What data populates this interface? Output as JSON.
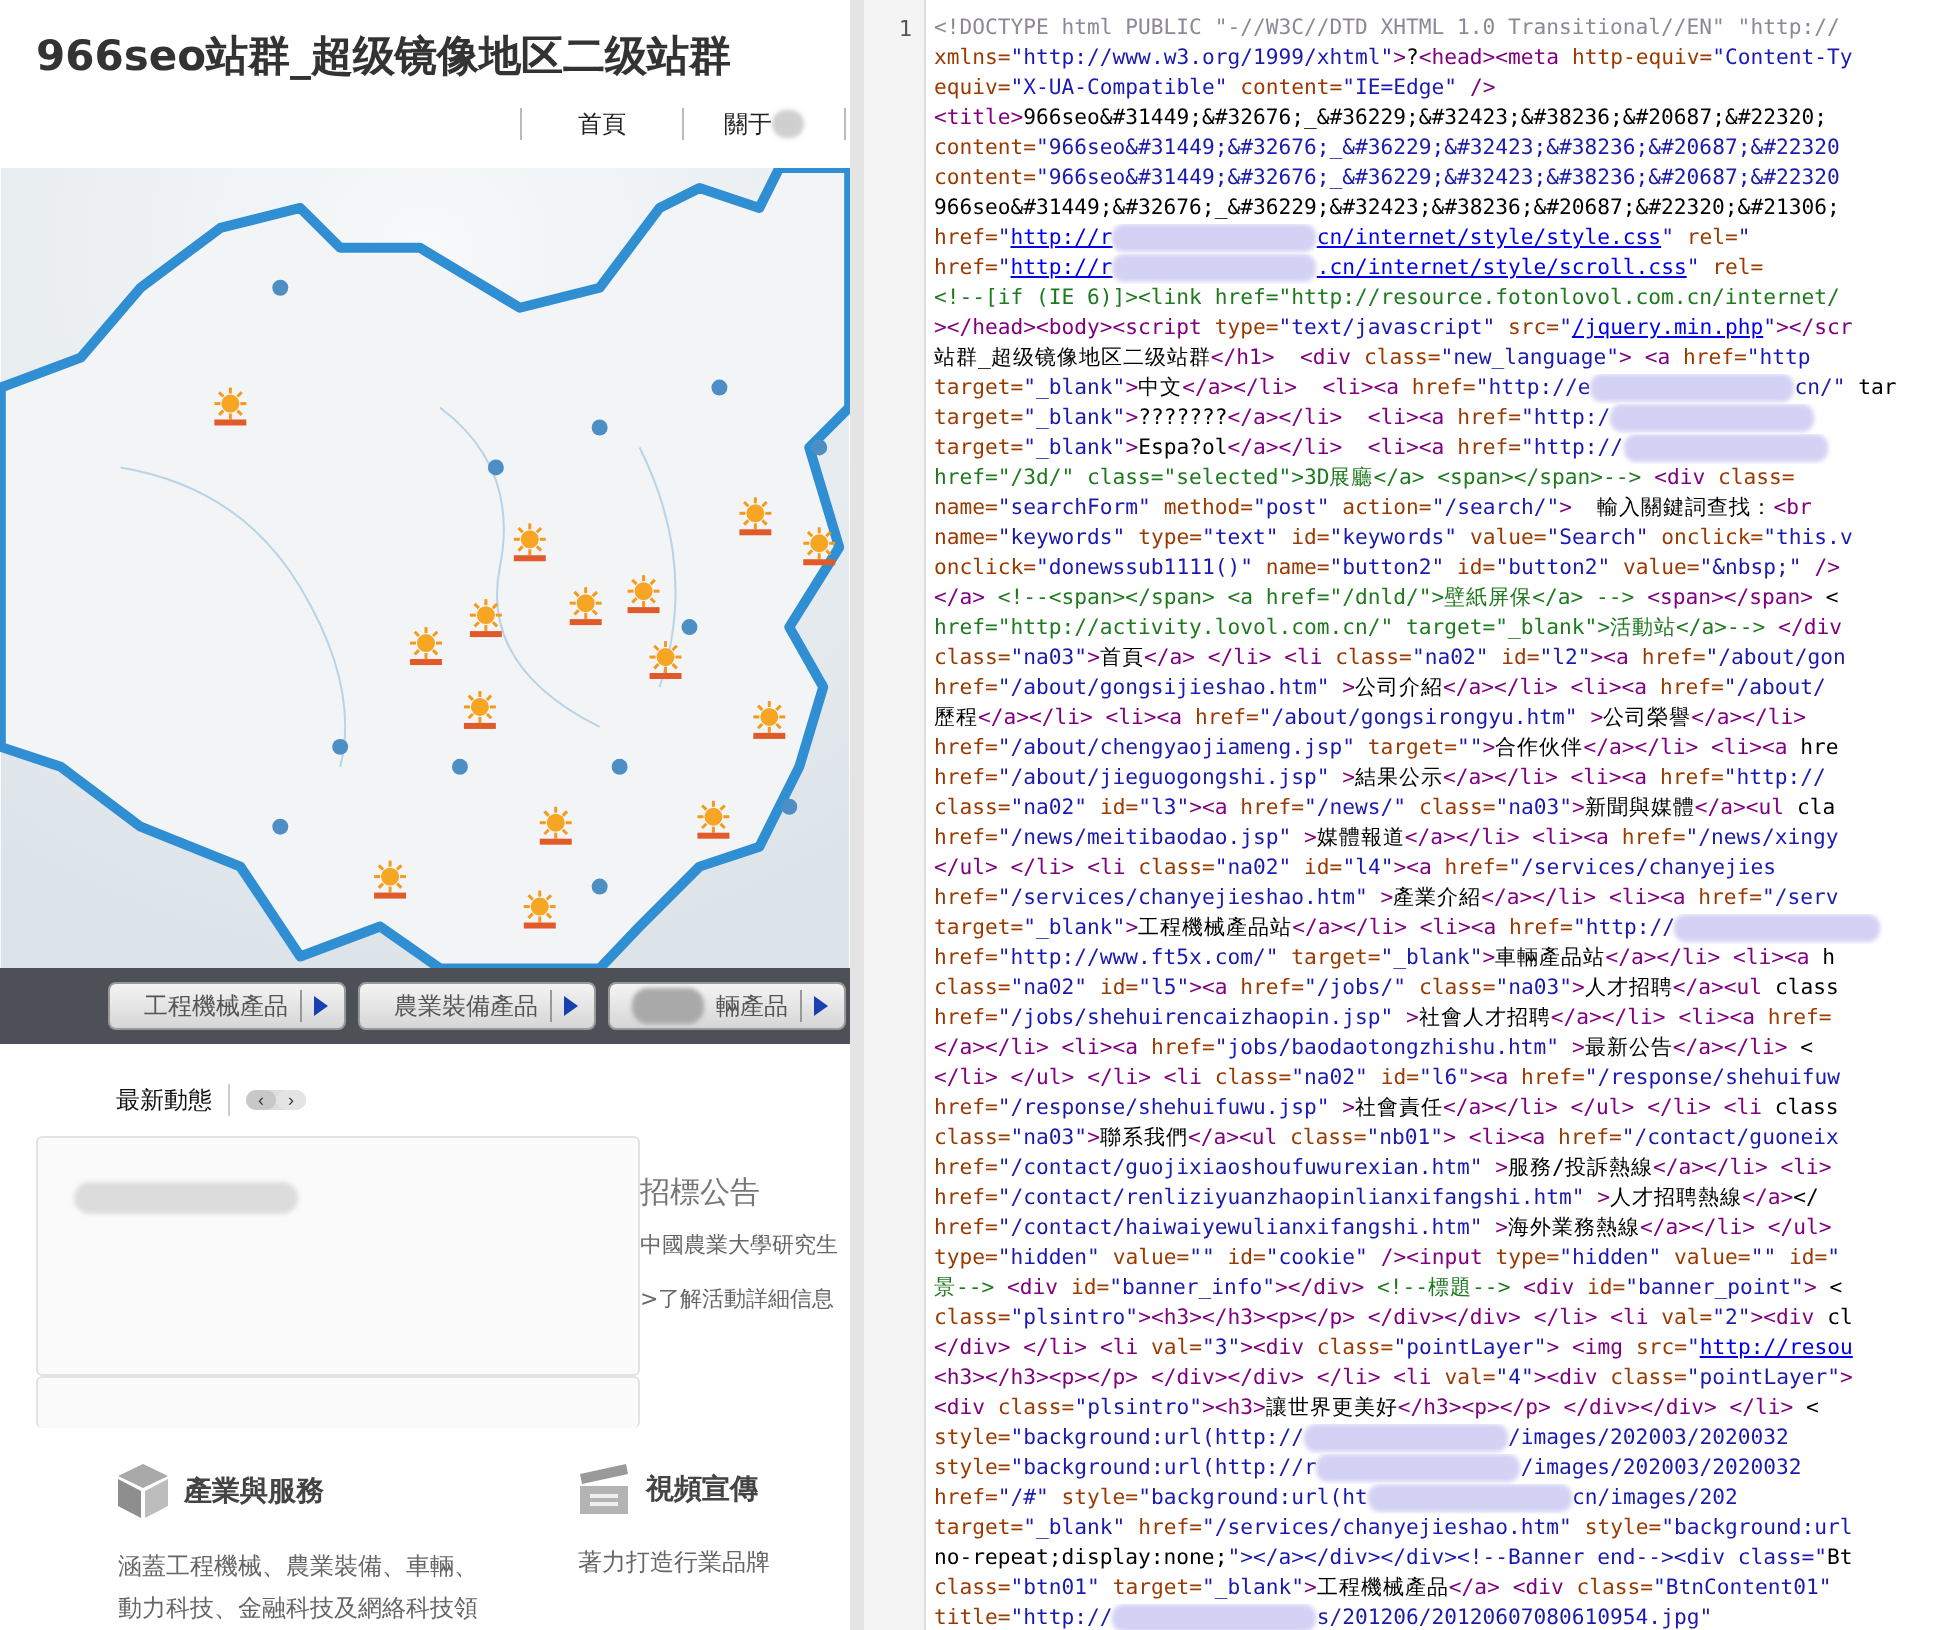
{
  "site": {
    "title": "966seo站群_超级镜像地区二级站群",
    "nav": [
      {
        "label": "首頁",
        "redacted": false
      },
      {
        "label": "關于",
        "redacted": true
      }
    ],
    "category_buttons": [
      {
        "label": "工程機械產品",
        "redacted": false
      },
      {
        "label": "農業裝備產品",
        "redacted": false
      },
      {
        "label": "輛產品",
        "redacted": true
      }
    ],
    "news": {
      "heading": "最新動態",
      "prev": "‹",
      "next": "›"
    },
    "tenders": {
      "heading": "招標公告",
      "item": "中國農業大學研究生",
      "more": ">了解活動詳細信息"
    },
    "features": [
      {
        "kind": "cube",
        "title": "產業與服務",
        "text": "涵蓋工程機械、農業裝備、車輛、動力科技、金融科技及網絡科技領"
      },
      {
        "kind": "clapper",
        "title": "視頻宣傳",
        "text": "著力打造行業品牌"
      }
    ]
  },
  "source": {
    "line_number": "1",
    "lines": [
      {
        "parts": [
          {
            "kind": "doctype",
            "text": "<!DOCTYPE html PUBLIC \"-//W3C//DTD XHTML 1.0 Transitional//EN\" \"http://"
          }
        ]
      },
      {
        "parts": [
          {
            "kind": "code",
            "text": "xmlns=\"http://www.w3.org/1999/xhtml\">?<head><meta http-equiv=\"Content-Ty"
          }
        ]
      },
      {
        "parts": [
          {
            "kind": "code",
            "text": "equiv=\"X-UA-Compatible\" content=\"IE=Edge\" />"
          }
        ]
      },
      {
        "parts": [
          {
            "kind": "code",
            "text": "<title>966seo&#31449;&#32676;_&#36229;&#32423;&#38236;&#20687;&#22320;"
          }
        ]
      },
      {
        "parts": [
          {
            "kind": "code",
            "text": "content=\"966seo&#31449;&#32676;_&#36229;&#32423;&#38236;&#20687;&#22320"
          }
        ]
      },
      {
        "parts": [
          {
            "kind": "code",
            "text": "content=\"966seo&#31449;&#32676;_&#36229;&#32423;&#38236;&#20687;&#22320"
          }
        ]
      },
      {
        "parts": [
          {
            "kind": "code",
            "text": "966seo&#31449;&#32676;_&#36229;&#32423;&#38236;&#20687;&#22320;&#21306;"
          }
        ]
      },
      {
        "parts": [
          {
            "kind": "code",
            "text": "href=\""
          },
          {
            "kind": "link",
            "text": "http://r"
          },
          {
            "kind": "redacted"
          },
          {
            "kind": "link",
            "text": "cn/internet/style/style.css"
          },
          {
            "kind": "code",
            "text": "\" rel=\""
          }
        ]
      },
      {
        "parts": [
          {
            "kind": "code",
            "text": "href=\""
          },
          {
            "kind": "link",
            "text": "http://r"
          },
          {
            "kind": "redacted"
          },
          {
            "kind": "link",
            "text": ".cn/internet/style/scroll.css"
          },
          {
            "kind": "code",
            "text": "\" rel="
          }
        ]
      },
      {
        "parts": [
          {
            "kind": "code",
            "text": "<!--[if (IE 6)]><link href=\"http://resource.fotonlovol.com.cn/internet/"
          }
        ]
      },
      {
        "parts": [
          {
            "kind": "code",
            "text": "></head><body><script type=\"text/javascript\" src=\""
          },
          {
            "kind": "link",
            "text": "/jquery.min.php"
          },
          {
            "kind": "code",
            "text": "\"></scr"
          }
        ]
      },
      {
        "parts": [
          {
            "kind": "code",
            "text": "站群_超级镜像地区二级站群</h1>  <div class=\"new_language\"> <a href=\"http"
          }
        ]
      },
      {
        "parts": [
          {
            "kind": "code",
            "text": "target=\"_blank\">中文</a></li>  <li><a href=\"http://e"
          },
          {
            "kind": "redacted"
          },
          {
            "kind": "code",
            "text": "cn/\" tar"
          }
        ]
      },
      {
        "parts": [
          {
            "kind": "code",
            "text": "target=\"_blank\">???????</a></li>  <li><a href=\"http:/"
          },
          {
            "kind": "redacted"
          }
        ]
      },
      {
        "parts": [
          {
            "kind": "code",
            "text": "target=\"_blank\">Espa?ol</a></li>  <li><a href=\"http://"
          },
          {
            "kind": "redacted"
          }
        ]
      },
      {
        "parts": [
          {
            "kind": "comment",
            "text": "href=\"/3d/\" class=\"selected\">"
          },
          {
            "kind": "comment",
            "text": "3D展廳</a> <span></span>-->"
          },
          {
            "kind": "code",
            "text": " <div class="
          }
        ]
      },
      {
        "parts": [
          {
            "kind": "code",
            "text": "name=\"searchForm\" method=\"post\" action=\"/search/\">  輸入關鍵詞查找：<br"
          }
        ]
      },
      {
        "parts": [
          {
            "kind": "code",
            "text": "name=\"keywords\" type=\"text\" id=\"keywords\" value=\"Search\" onclick=\"this.v"
          }
        ]
      },
      {
        "parts": [
          {
            "kind": "code",
            "text": "onclick=\"donewssub1111()\" name=\"button2\" id=\"button2\" value=\"&nbsp;\" />"
          }
        ]
      },
      {
        "parts": [
          {
            "kind": "code",
            "text": "</a> <!--<span></span> <a href=\"/dnld/\">壁紙屏保</a> --> <span></span> <"
          }
        ]
      },
      {
        "parts": [
          {
            "kind": "comment",
            "text": "href=\"http://activity.lovol.com.cn/\" target=\"_blank\">活動站</a>-->"
          },
          {
            "kind": "code",
            "text": " </div"
          }
        ]
      },
      {
        "parts": [
          {
            "kind": "code",
            "text": "class=\"na03\">首頁</a> </li> <li class=\"na02\" id=\"l2\"><a href=\"/about/gon"
          }
        ]
      },
      {
        "parts": [
          {
            "kind": "code",
            "text": "href=\"/about/gongsijieshao.htm\" >公司介紹</a></li> <li><a href=\"/about/"
          }
        ]
      },
      {
        "parts": [
          {
            "kind": "code",
            "text": "歷程</a></li> <li><a href=\"/about/gongsirongyu.htm\" >公司榮譽</a></li>"
          }
        ]
      },
      {
        "parts": [
          {
            "kind": "code",
            "text": "href=\"/about/chengyaojiameng.jsp\" target=\"\">合作伙伴</a></li> <li><a hre"
          }
        ]
      },
      {
        "parts": [
          {
            "kind": "code",
            "text": "href=\"/about/jieguogongshi.jsp\" >結果公示</a></li> <li><a href=\"http://"
          }
        ]
      },
      {
        "parts": [
          {
            "kind": "code",
            "text": "class=\"na02\" id=\"l3\"><a href=\"/news/\" class=\"na03\">新聞與媒體</a><ul cla"
          }
        ]
      },
      {
        "parts": [
          {
            "kind": "code",
            "text": "href=\"/news/meitibaodao.jsp\" >媒體報道</a></li> <li><a href=\"/news/xingy"
          }
        ]
      },
      {
        "parts": [
          {
            "kind": "code",
            "text": "</ul> </li> <li class=\"na02\" id=\"l4\"><a href=\"/services/chanyejies"
          }
        ]
      },
      {
        "parts": [
          {
            "kind": "code",
            "text": "href=\"/services/chanyejieshao.htm\" >產業介紹</a></li> <li><a href=\"/serv"
          }
        ]
      },
      {
        "parts": [
          {
            "kind": "code",
            "text": "target=\"_blank\">工程機械產品站</a></li> <li><a href=\"http://"
          },
          {
            "kind": "redacted"
          }
        ]
      },
      {
        "parts": [
          {
            "kind": "code",
            "text": "href=\"http://www.ft5x.com/\" target=\"_blank\">車輛產品站</a></li> <li><a h"
          }
        ]
      },
      {
        "parts": [
          {
            "kind": "code",
            "text": "class=\"na02\" id=\"l5\"><a href=\"/jobs/\" class=\"na03\">人才招聘</a><ul class"
          }
        ]
      },
      {
        "parts": [
          {
            "kind": "code",
            "text": "href=\"/jobs/shehuirencaizhaopin.jsp\" >社會人才招聘</a></li> <li><a href="
          }
        ]
      },
      {
        "parts": [
          {
            "kind": "code",
            "text": "</a></li> <li><a href=\"jobs/baodaotongzhishu.htm\" >最新公告</a></li> <"
          }
        ]
      },
      {
        "parts": [
          {
            "kind": "code",
            "text": "</li> </ul> </li> <li class=\"na02\" id=\"l6\"><a href=\"/response/shehuifuw"
          }
        ]
      },
      {
        "parts": [
          {
            "kind": "code",
            "text": "href=\"/response/shehuifuwu.jsp\" >社會責任</a></li> </ul> </li> <li class"
          }
        ]
      },
      {
        "parts": [
          {
            "kind": "code",
            "text": "class=\"na03\">聯系我們</a><ul class=\"nb01\"> <li><a href=\"/contact/guoneix"
          }
        ]
      },
      {
        "parts": [
          {
            "kind": "code",
            "text": "href=\"/contact/guojixiaoshoufuwurexian.htm\" >服務/投訴熱線</a></li> <li>"
          }
        ]
      },
      {
        "parts": [
          {
            "kind": "code",
            "text": "href=\"/contact/renliziyuanzhaopinlianxifangshi.htm\" >人才招聘熱線</a></"
          }
        ]
      },
      {
        "parts": [
          {
            "kind": "code",
            "text": "href=\"/contact/haiwaiyewulianxifangshi.htm\" >海外業務熱線</a></li> </ul>"
          }
        ]
      },
      {
        "parts": [
          {
            "kind": "code",
            "text": "type=\"hidden\" value=\"\" id=\"cookie\" /><input type=\"hidden\" value=\"\" id=\""
          }
        ]
      },
      {
        "parts": [
          {
            "kind": "comment",
            "text": "景-->"
          },
          {
            "kind": "code",
            "text": " <div id=\"banner_info\"></div> <!--標題--> <div id=\"banner_point\"> <"
          }
        ]
      },
      {
        "parts": [
          {
            "kind": "code",
            "text": "class=\"plsintro\"><h3></h3><p></p> </div></div> </li> <li val=\"2\"><div cl"
          }
        ]
      },
      {
        "parts": [
          {
            "kind": "code",
            "text": "</div> </li> <li val=\"3\"><div class=\"pointLayer\"> <img src=\""
          },
          {
            "kind": "link",
            "text": "http://resou"
          }
        ]
      },
      {
        "parts": [
          {
            "kind": "code",
            "text": "<h3></h3><p></p> </div></div> </li> <li val=\"4\"><div class=\"pointLayer\">"
          }
        ]
      },
      {
        "parts": [
          {
            "kind": "code",
            "text": "<div class=\"plsintro\"><h3>讓世界更美好</h3><p></p> </div></div> </li> <"
          }
        ]
      },
      {
        "parts": [
          {
            "kind": "code",
            "text": "style=\"background:url(http://"
          },
          {
            "kind": "redacted"
          },
          {
            "kind": "code",
            "text": "/images/202003/2020032"
          }
        ]
      },
      {
        "parts": [
          {
            "kind": "code",
            "text": "style=\"background:url(http://r"
          },
          {
            "kind": "redacted"
          },
          {
            "kind": "code",
            "text": "/images/202003/2020032"
          }
        ]
      },
      {
        "parts": [
          {
            "kind": "code",
            "text": "href=\"/#\" style=\"background:url(ht"
          },
          {
            "kind": "redacted"
          },
          {
            "kind": "code",
            "text": "cn/images/202"
          }
        ]
      },
      {
        "parts": [
          {
            "kind": "code",
            "text": "target=\"_blank\" href=\"/services/chanyejieshao.htm\" style=\"background:url"
          }
        ]
      },
      {
        "parts": [
          {
            "kind": "code",
            "text": "no-repeat;display:none;\"></a></div></div><!--Banner end--><div class=\"Bt"
          }
        ]
      },
      {
        "parts": [
          {
            "kind": "code",
            "text": "class=\"btn01\" target=\"_blank\">工程機械產品</a> <div class=\"BtnContent01\""
          }
        ]
      },
      {
        "parts": [
          {
            "kind": "code",
            "text": "title=\"http://"
          },
          {
            "kind": "redacted"
          },
          {
            "kind": "code",
            "text": "s/201206/20120607080610954.jpg\""
          }
        ]
      }
    ]
  }
}
